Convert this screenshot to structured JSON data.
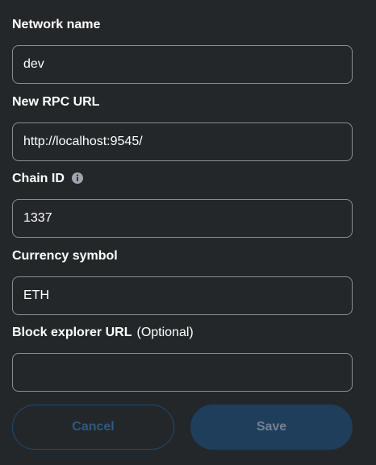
{
  "form": {
    "network_name": {
      "label": "Network name",
      "value": "dev"
    },
    "rpc_url": {
      "label": "New RPC URL",
      "value": "http://localhost:9545/"
    },
    "chain_id": {
      "label": "Chain ID",
      "value": "1337",
      "icon": "info-icon"
    },
    "currency_symbol": {
      "label": "Currency symbol",
      "value": "ETH"
    },
    "block_explorer": {
      "label": "Block explorer URL",
      "optional": "(Optional)",
      "value": ""
    }
  },
  "buttons": {
    "cancel_label": "Cancel",
    "save_label": "Save"
  },
  "colors": {
    "background": "#24272a",
    "text": "#ffffff",
    "field_border": "#8d8d8d",
    "cancel_border": "#1e4a72",
    "cancel_text": "#2c5a85",
    "save_bg": "#1f3e5c",
    "save_text": "#74818e"
  }
}
